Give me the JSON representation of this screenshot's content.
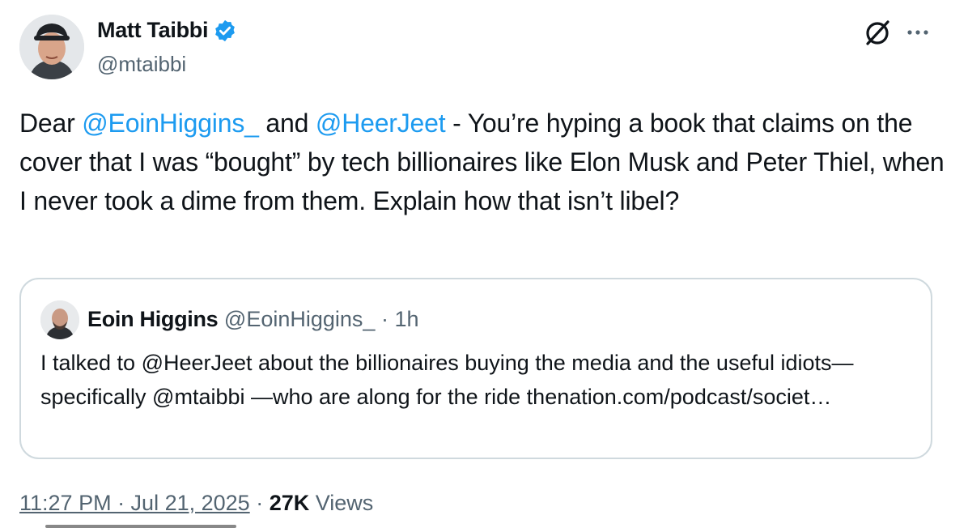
{
  "author": {
    "display_name": "Matt Taibbi",
    "handle": "@mtaibbi",
    "verified": true
  },
  "tweet": {
    "text_parts": {
      "p1": "Dear ",
      "mention1": "@EoinHiggins_",
      "p2": " and ",
      "mention2": "@HeerJeet",
      "p3": " - You’re hyping a book that claims on the cover that I was “bought” by tech billionaires like Elon Musk and Peter Thiel, when I never took a dime from them. Explain how that isn’t libel?"
    }
  },
  "quote": {
    "display_name": "Eoin Higgins",
    "handle": "@EoinHiggins_",
    "separator": "·",
    "time": "1h",
    "text": "I talked to @HeerJeet about the billionaires buying the media and the useful idiots—specifically @mtaibbi —who are along for the ride thenation.com/podcast/societ…"
  },
  "footer": {
    "timestamp": "11:27 PM · Jul 21, 2025",
    "separator": "·",
    "views_count": "27K",
    "views_label": "Views"
  },
  "icons": {
    "verified": "verified-badge-icon",
    "grok": "grok-icon",
    "more": "more-icon"
  },
  "colors": {
    "accent": "#1d9bf0",
    "text": "#0f1419",
    "secondary": "#536471",
    "border": "#cfd9de"
  }
}
